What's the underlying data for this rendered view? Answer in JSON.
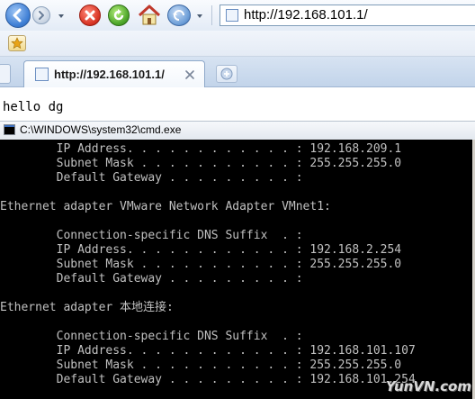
{
  "browser": {
    "address": "http://192.168.101.1/",
    "tab_title": "http://192.168.101.1/"
  },
  "page": {
    "body_text": "hello dg"
  },
  "cmd": {
    "title": "C:\\WINDOWS\\system32\\cmd.exe",
    "lines": [
      "        IP Address. . . . . . . . . . . . : 192.168.209.1",
      "        Subnet Mask . . . . . . . . . . . : 255.255.255.0",
      "        Default Gateway . . . . . . . . . :",
      "",
      "Ethernet adapter VMware Network Adapter VMnet1:",
      "",
      "        Connection-specific DNS Suffix  . :",
      "        IP Address. . . . . . . . . . . . : 192.168.2.254",
      "        Subnet Mask . . . . . . . . . . . : 255.255.255.0",
      "        Default Gateway . . . . . . . . . :",
      "",
      "Ethernet adapter 本地连接:",
      "",
      "        Connection-specific DNS Suffix  . :",
      "        IP Address. . . . . . . . . . . . : 192.168.101.107",
      "        Subnet Mask . . . . . . . . . . . : 255.255.255.0",
      "        Default Gateway . . . . . . . . . : 192.168.101.254"
    ]
  },
  "watermark": "YunVN.com",
  "colors": {
    "console_bg": "#000000",
    "console_fg": "#c0c0c0",
    "accent": "#3f7fd5"
  },
  "icons": [
    "back-icon",
    "forward-icon",
    "stop-icon",
    "refresh-icon",
    "home-icon",
    "history-icon",
    "favorites-star-icon",
    "page-icon",
    "close-icon",
    "new-tab-icon",
    "cmd-icon"
  ]
}
